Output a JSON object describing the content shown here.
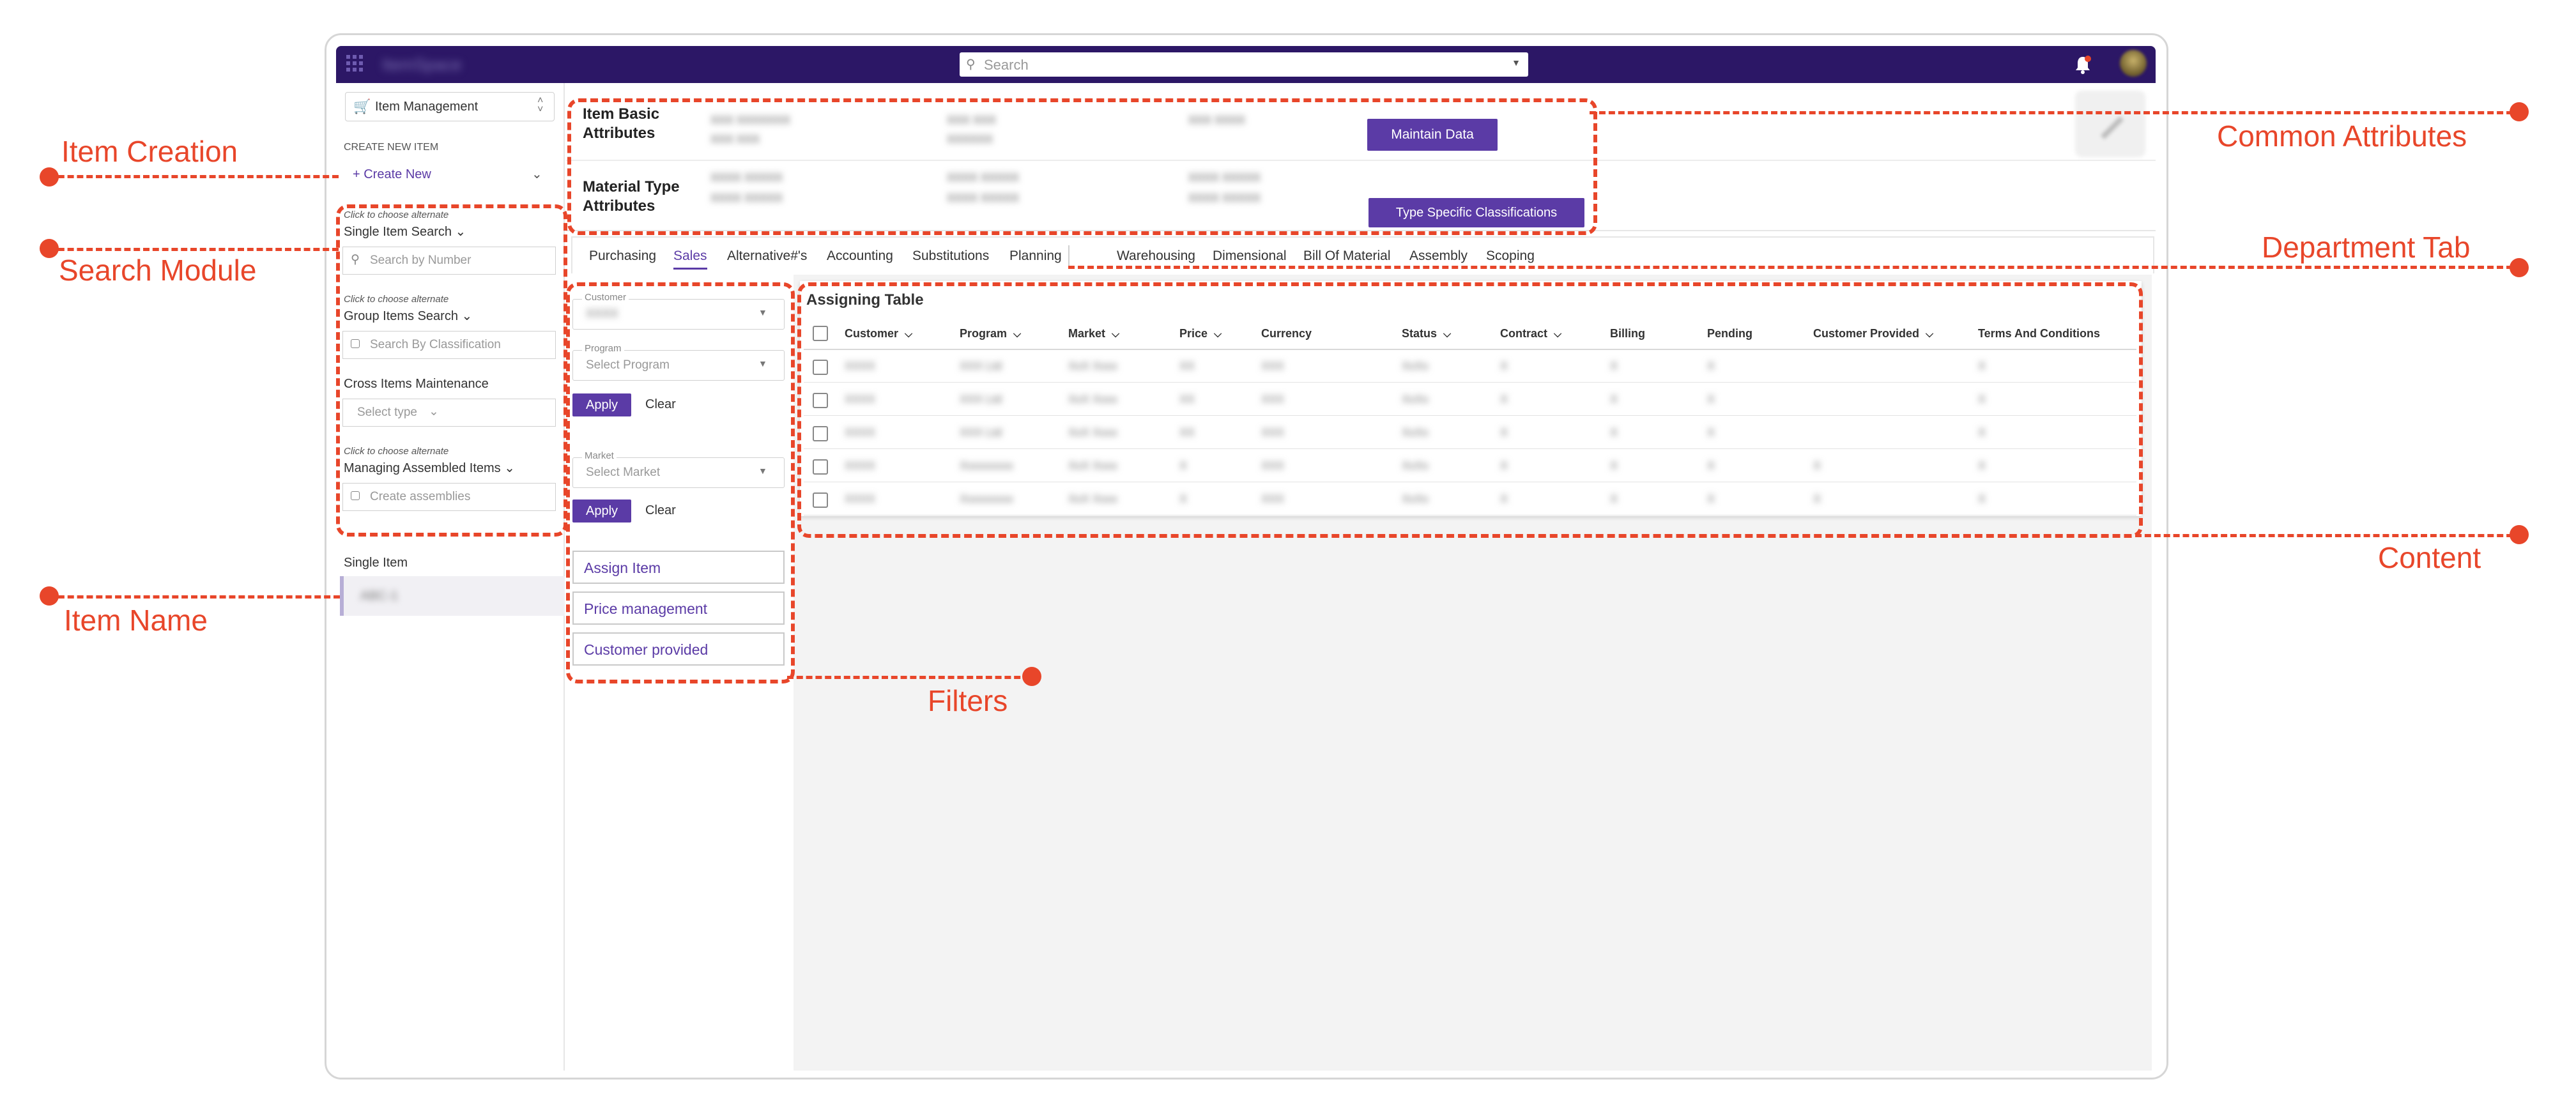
{
  "header": {
    "app_name": "ItemSpace",
    "search_placeholder": "Search",
    "icons": [
      "grid-icon",
      "search-icon",
      "bell-icon",
      "avatar"
    ]
  },
  "sidebar": {
    "module": "Item Management",
    "create_section_label": "CREATE NEW ITEM",
    "create_new": "+ Create New",
    "alt_hint": "Click to choose alternate",
    "single_search": "Single Item Search",
    "search_by_number": "Search by Number",
    "group_search": "Group Items Search",
    "search_by_classification": "Search By Classification",
    "cross_maintenance": "Cross Items Maintenance",
    "select_type": "Select type",
    "managing_assembled": "Managing Assembled Items",
    "create_assemblies": "Create assemblies",
    "single_item_label": "Single Item",
    "item_value": "ABC-1"
  },
  "attributes": {
    "basic_title": "Item Basic Attributes",
    "material_title": "Material Type Attributes",
    "basic_values": [
      [
        "XXX XXXXXXX",
        "XXX XXX"
      ],
      [
        "XXX XXX",
        "XXXXXX"
      ],
      [
        "XXX XXXX",
        ""
      ]
    ],
    "material_values": [
      [
        "XXXX XXXXX",
        "XXXX XXXXX"
      ],
      [
        "XXXX XXXXX",
        "XXXX XXXXX"
      ],
      [
        "XXXX XXXXX",
        "XXXX XXXXX"
      ]
    ],
    "maintain_button": "Maintain Data",
    "classifications_button": "Type Specific Classifications"
  },
  "tabs": {
    "left": [
      "Purchasing",
      "Sales",
      "Alternative#'s",
      "Accounting",
      "Substitutions",
      "Planning"
    ],
    "right": [
      "Warehousing",
      "Dimensional",
      "Bill Of Material",
      "Assembly",
      "Scoping"
    ],
    "active": "Sales"
  },
  "filters": {
    "customer_label": "Customer",
    "customer_value": "XXXX",
    "program_label": "Program",
    "program_placeholder": "Select Program",
    "market_label": "Market",
    "market_placeholder": "Select Market",
    "apply": "Apply",
    "clear": "Clear",
    "links": [
      "Assign Item",
      "Price management",
      "Customer provided"
    ]
  },
  "table": {
    "title": "Assigning Table",
    "columns": [
      "Customer",
      "Program",
      "Market",
      "Price",
      "Currency",
      "Status",
      "Contract",
      "Billing",
      "Pending",
      "Customer Provided",
      "Terms And Conditions"
    ],
    "sortable": [
      true,
      true,
      true,
      true,
      false,
      true,
      true,
      false,
      false,
      true,
      false
    ],
    "rows": [
      [
        "XXXX",
        "XXX Ltd",
        "XxX Xxxx",
        "XX",
        "XXX",
        "XxXx",
        "X",
        "X",
        "X",
        "",
        "X"
      ],
      [
        "XXXX",
        "XXX Ltd",
        "XxX Xxxx",
        "XX",
        "XXX",
        "XxXx",
        "X",
        "X",
        "X",
        "",
        "X"
      ],
      [
        "XXXX",
        "XXX Ltd",
        "XxX Xxxx",
        "XX",
        "XXX",
        "XxXx",
        "X",
        "X",
        "X",
        "",
        "X"
      ],
      [
        "XXXX",
        "Xxxxxxxxx",
        "XxX Xxxx",
        "X",
        "XXX",
        "XxXx",
        "X",
        "X",
        "X",
        "X",
        "X"
      ],
      [
        "XXXX",
        "Xxxxxxxxx",
        "XxX Xxxx",
        "X",
        "XXX",
        "XxXx",
        "X",
        "X",
        "X",
        "X",
        "X"
      ]
    ]
  },
  "callouts": {
    "item_creation": "Item Creation",
    "search_module": "Search Module",
    "item_name": "Item Name",
    "common_attributes": "Common Attributes",
    "department_tab": "Department Tab",
    "content": "Content",
    "filters": "Filters"
  },
  "colors": {
    "accent": "#5b3ba6",
    "header_bg": "#2c1766",
    "callout": "#e8462a"
  }
}
